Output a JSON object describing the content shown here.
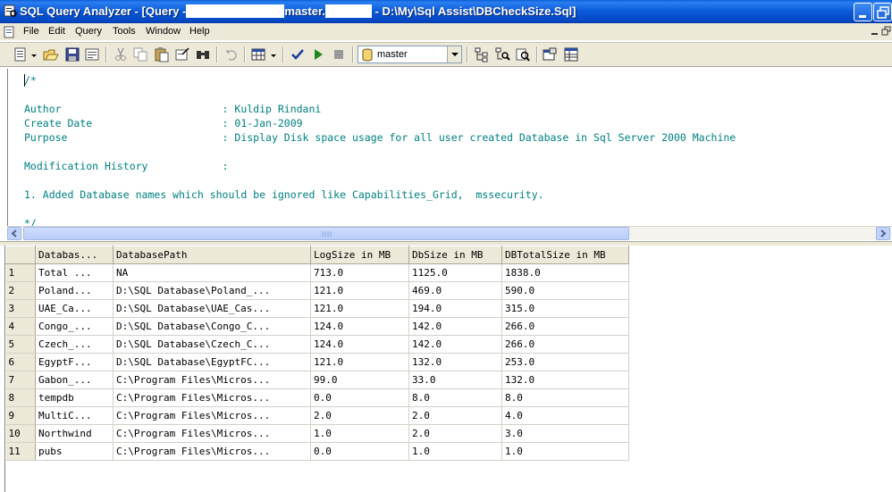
{
  "window": {
    "title_prefix": "SQL Query Analyzer - [Query -",
    "title_mid": "master.",
    "title_suffix": "- D:\\My\\Sql Assist\\DBCheckSize.Sql]"
  },
  "menu": [
    "File",
    "Edit",
    "Query",
    "Tools",
    "Window",
    "Help"
  ],
  "toolbar": {
    "database": "master"
  },
  "editor": {
    "lines": [
      "/*",
      "",
      "Author                          : Kuldip Rindani",
      "Create Date                     : 01-Jan-2009",
      "Purpose                         : Display Disk space usage for all user created Database in Sql Server 2000 Machine",
      "",
      "Modification History            :",
      "",
      "1. Added Database names which should be ignored like Capabilities_Grid,  mssecurity.",
      "",
      "*/"
    ]
  },
  "results": {
    "columns": [
      "Databas...",
      "DatabasePath",
      "LogSize in MB",
      "DbSize in MB",
      "DBTotalSize in MB"
    ],
    "rows": [
      [
        "1",
        "Total ...",
        "NA",
        "713.0",
        "1125.0",
        "1838.0"
      ],
      [
        "2",
        "Poland...",
        "D:\\SQL Database\\Poland_...",
        "121.0",
        "469.0",
        "590.0"
      ],
      [
        "3",
        "UAE_Ca...",
        "D:\\SQL Database\\UAE_Cas...",
        "121.0",
        "194.0",
        "315.0"
      ],
      [
        "4",
        "Congo_...",
        "D:\\SQL Database\\Congo_C...",
        "124.0",
        "142.0",
        "266.0"
      ],
      [
        "5",
        "Czech_...",
        "D:\\SQL Database\\Czech_C...",
        "124.0",
        "142.0",
        "266.0"
      ],
      [
        "6",
        "EgyptF...",
        "D:\\SQL Database\\EgyptFC...",
        "121.0",
        "132.0",
        "253.0"
      ],
      [
        "7",
        "Gabon_...",
        "C:\\Program Files\\Micros...",
        "99.0",
        "33.0",
        "132.0"
      ],
      [
        "8",
        "tempdb",
        "C:\\Program Files\\Micros...",
        "0.0",
        "8.0",
        "8.0"
      ],
      [
        "9",
        "MultiC...",
        "C:\\Program Files\\Micros...",
        "2.0",
        "2.0",
        "4.0"
      ],
      [
        "10",
        "Northwind",
        "C:\\Program Files\\Micros...",
        "1.0",
        "2.0",
        "3.0"
      ],
      [
        "11",
        "pubs",
        "C:\\Program Files\\Micros...",
        "0.0",
        "1.0",
        "1.0"
      ]
    ]
  }
}
